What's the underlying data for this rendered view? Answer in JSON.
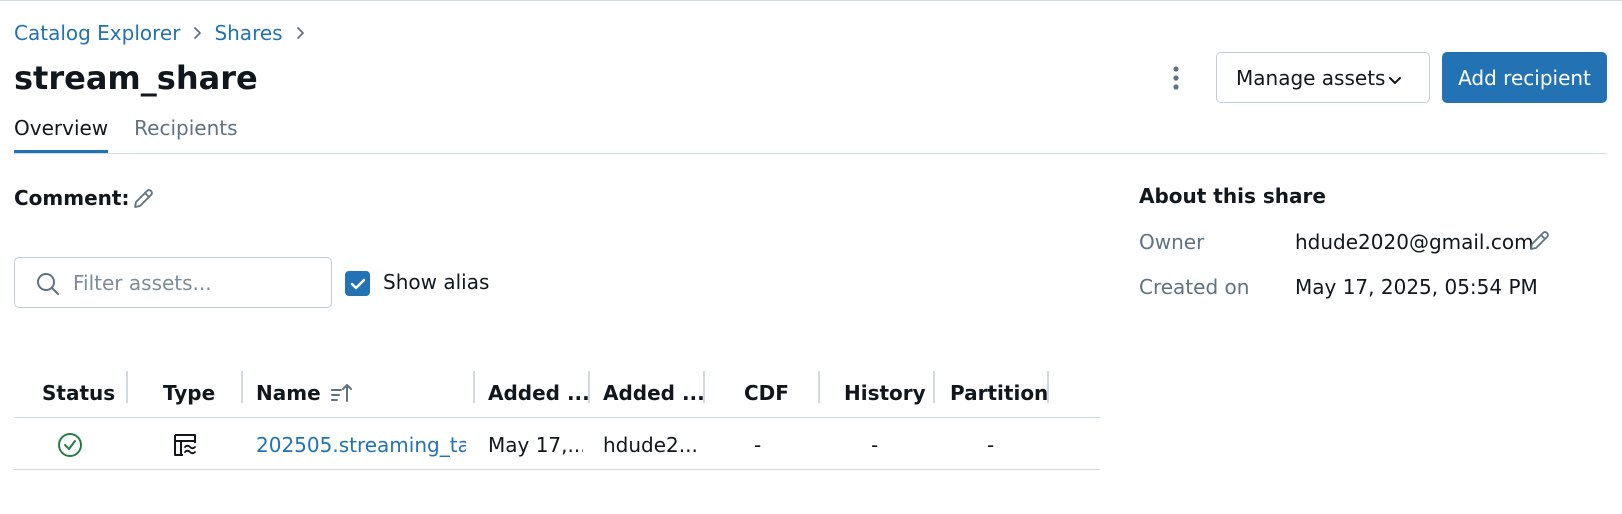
{
  "breadcrumb": {
    "items": [
      "Catalog Explorer",
      "Shares"
    ],
    "separator": "›"
  },
  "page": {
    "title": "stream_share"
  },
  "actions": {
    "manage_label": "Manage assets",
    "add_label": "Add recipient"
  },
  "tabs": [
    {
      "label": "Overview",
      "active": true
    },
    {
      "label": "Recipients",
      "active": false
    }
  ],
  "comment": {
    "label": "Comment:"
  },
  "filter": {
    "placeholder": "Filter assets..."
  },
  "show_alias": {
    "label": "Show alias",
    "checked": true
  },
  "table": {
    "columns": [
      "Status",
      "Type",
      "Name",
      "Added ...",
      "Added ...",
      "CDF",
      "History",
      "Partition"
    ],
    "rows": [
      {
        "status": "success",
        "type": "streaming-table",
        "name": "202505.streaming_ta...",
        "added_on": "May 17,...",
        "added_by": "hdude2...",
        "cdf": "-",
        "history": "-",
        "partition": "-"
      }
    ]
  },
  "about": {
    "title": "About this share",
    "owner_label": "Owner",
    "owner_value": "hdude2020@gmail.com",
    "created_label": "Created on",
    "created_value": "May 17, 2025, 05:54 PM"
  },
  "colors": {
    "accent": "#2272b4",
    "success": "#277c43",
    "border": "#d1d9e1",
    "muted": "#5f7281"
  }
}
